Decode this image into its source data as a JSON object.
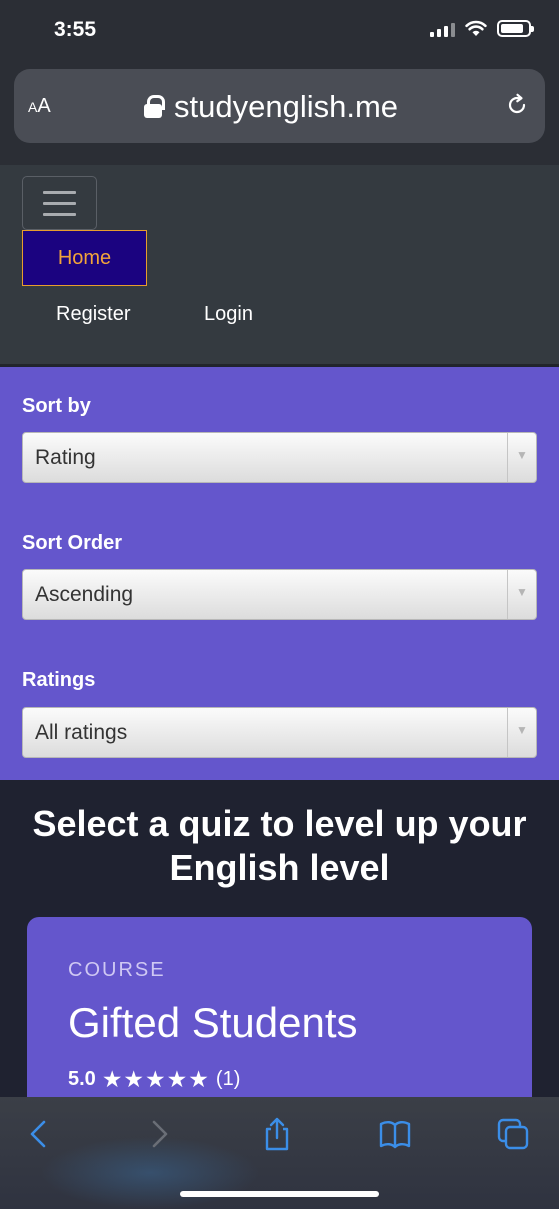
{
  "status_bar": {
    "time": "3:55"
  },
  "browser": {
    "text_size_label_small": "A",
    "text_size_label_large": "A",
    "url": "studyenglish.me"
  },
  "navbar": {
    "home": "Home",
    "register": "Register",
    "login": "Login"
  },
  "filters": {
    "sort_by": {
      "label": "Sort by",
      "value": "Rating"
    },
    "sort_order": {
      "label": "Sort Order",
      "value": "Ascending"
    },
    "ratings": {
      "label": "Ratings",
      "value": "All ratings"
    }
  },
  "main": {
    "heading": "Select a quiz to level up your English level",
    "card": {
      "kicker": "COURSE",
      "title": "Gifted Students",
      "rating": "5.0",
      "stars": "★★★★★",
      "count": "(1)"
    }
  },
  "colors": {
    "navbar_bg": "#343a40",
    "accent_purple": "#6456cc",
    "home_bg": "#1b0380",
    "home_text": "#f2a43a",
    "toolbar_icon": "#3b8ee8"
  }
}
